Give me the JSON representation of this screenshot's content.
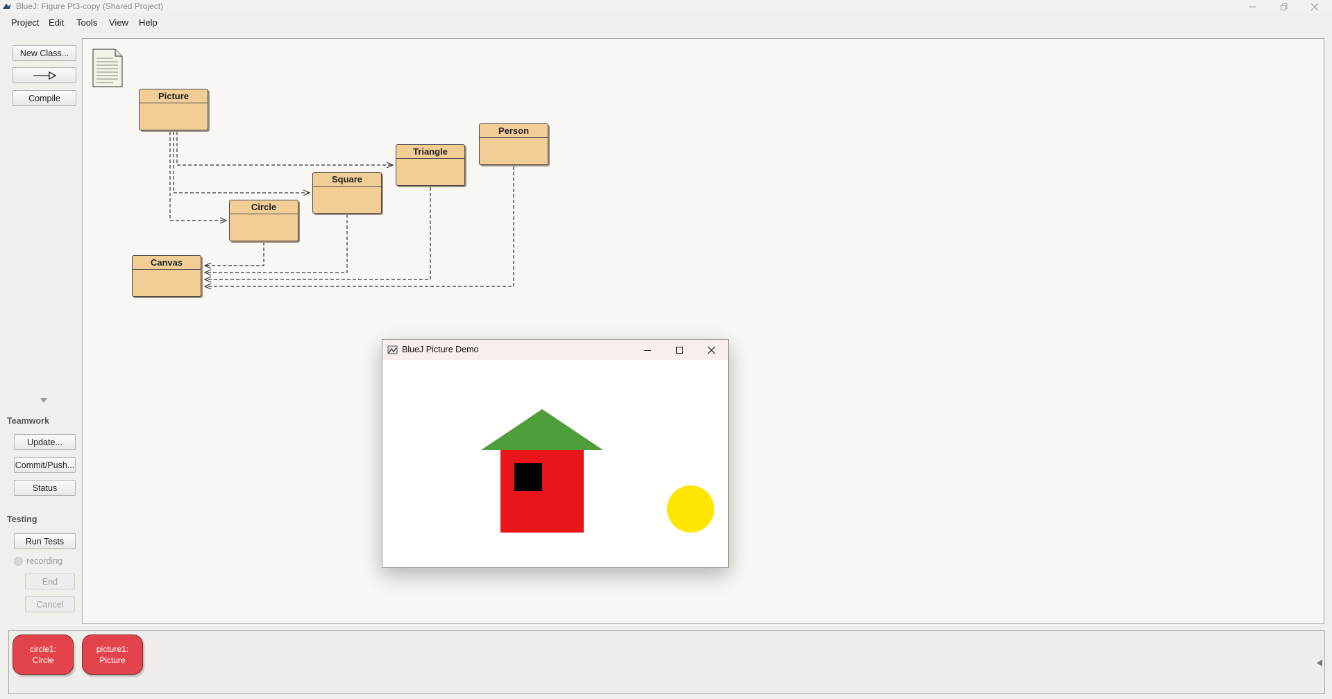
{
  "window": {
    "title": "BlueJ:  Figure Pt3-copy (Shared Project)",
    "controls": [
      "minimize-icon",
      "maximize-icon",
      "close-icon"
    ]
  },
  "menu": [
    "Project",
    "Edit",
    "Tools",
    "View",
    "Help"
  ],
  "toolbar": {
    "new_class": "New Class...",
    "inherit_arrow_icon": "inheritance-arrow-icon",
    "compile": "Compile"
  },
  "teamwork": {
    "heading": "Teamwork",
    "update": "Update...",
    "commit": "Commit/Push...",
    "status": "Status"
  },
  "testing": {
    "heading": "Testing",
    "run_tests": "Run Tests",
    "recording": "recording",
    "end": "End",
    "cancel": "Cancel"
  },
  "diagram": {
    "readme_icon": "readme-document-icon",
    "classes": [
      "Picture",
      "Triangle",
      "Person",
      "Square",
      "Circle",
      "Canvas"
    ],
    "class_color": "#f2cd96"
  },
  "bench": {
    "objects": [
      {
        "line1": "circle1:",
        "line2": "Circle"
      },
      {
        "line1": "picture1:",
        "line2": "Picture"
      }
    ],
    "object_color": "#e3434a"
  },
  "demo_window": {
    "title": "BlueJ Picture Demo",
    "colors": {
      "roof": "#4f9e3c",
      "wall": "#e8161a",
      "window": "#000000",
      "sun": "#ffe600"
    }
  }
}
